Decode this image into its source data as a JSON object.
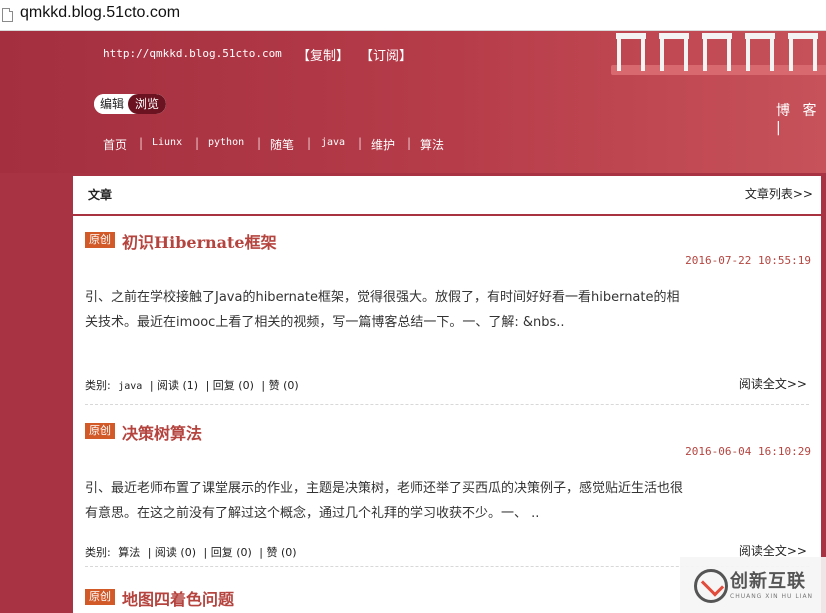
{
  "browser": {
    "url": "qmkkd.blog.51cto.com"
  },
  "header": {
    "blog_url": "http://qmkkd.blog.51cto.com",
    "copy_link": "【复制】",
    "subscribe_link": "【订阅】",
    "toggle_edit": "编辑",
    "toggle_browse": "浏览",
    "blog_label": "博 客 |",
    "nav": [
      "首页",
      "Liunx",
      "python",
      "随笔",
      "java",
      "维护",
      "算法"
    ]
  },
  "panel": {
    "title": "文章",
    "list_link": "文章列表>>"
  },
  "posts": [
    {
      "badge": "原创",
      "title": "初识Hibernate框架",
      "date": "2016-07-22 10:55:19",
      "excerpt": "引、之前在学校接触了Java的hibernate框架，觉得很强大。放假了，有时间好好看一看hibernate的相关技术。最近在imooc上看了相关的视频，写一篇博客总结一下。一、了解: &nbs..",
      "meta": {
        "category_label": "类别:",
        "category": "java",
        "read": "| 阅读 (1)",
        "reply": "| 回复 (0)",
        "like": "| 赞 (0)"
      },
      "readmore": "阅读全文>>"
    },
    {
      "badge": "原创",
      "title": "决策树算法",
      "date": "2016-06-04 16:10:29",
      "excerpt": "引、最近老师布置了课堂展示的作业，主题是决策树，老师还举了买西瓜的决策例子，感觉贴近生活也很有意思。在这之前没有了解过这个概念，通过几个礼拜的学习收获不少。一、 ..",
      "meta": {
        "category_label": "类别:",
        "category": "算法",
        "read": "| 阅读 (0)",
        "reply": "| 回复 (0)",
        "like": "| 赞 (0)"
      },
      "readmore": "阅读全文>>"
    },
    {
      "badge": "原创",
      "title": "地图四着色问题"
    }
  ],
  "watermark": {
    "text": "创新互联",
    "sub": "CHUANG XIN HU LIAN"
  }
}
